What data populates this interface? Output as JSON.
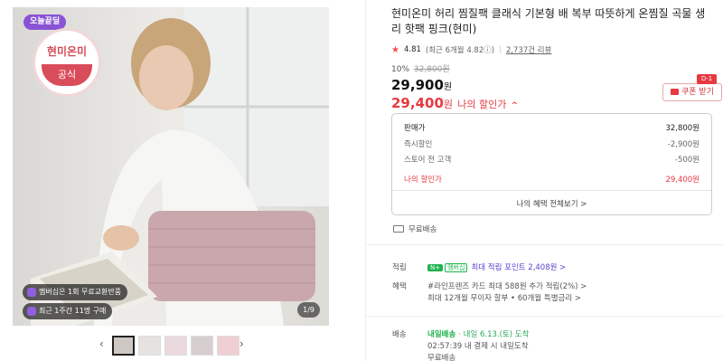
{
  "gallery": {
    "badge_today": "오늘끝딜",
    "brand_stamp_top": "현미온미",
    "brand_stamp_bottom": "공식",
    "pill_membership": "멤버십은 1회 무료교환반품",
    "pill_recent": "최근 1주간 11명 구매",
    "counter": "1/9",
    "arrow_left": "‹",
    "arrow_right": "›"
  },
  "product": {
    "title": "현미온미 허리 찜질팩 클래식 기본형 배 복부 따뜻하게 온찜질 곡물 생리 핫팩 핑크(현미)",
    "rating_star": "★",
    "rating_score": "4.81",
    "rating_recent": "(최근 6개월 4.82ⓘ)",
    "rating_sep": "|",
    "review_count": "2,737건 리뷰",
    "discount_pct": "10%",
    "original_price": "32,800원",
    "sale_price": "29,900",
    "sale_unit": "원",
    "my_price": "29,400",
    "my_unit": "원",
    "my_label": "나의 할인가",
    "my_caret": "^"
  },
  "coupon": {
    "dday": "D-1",
    "label": "쿠폰 받기"
  },
  "price_box": {
    "sale_label": "판매가",
    "sale_value": "32,800원",
    "instant_label": "즉시할인",
    "instant_value": "-2,900원",
    "store_label": "스토어 전 고객",
    "store_value": "-500원",
    "mine_label": "나의 할인가",
    "mine_value": "29,400원",
    "all_benefits": "나의 혜택 전체보기 >"
  },
  "shipping": {
    "free": "무료배송"
  },
  "points": {
    "label": "적립",
    "npay": "N+",
    "npoint": "멤버십",
    "text": "최대 적립 포인트 2,408원 >"
  },
  "benefits": {
    "label": "혜택",
    "line1": "#라인프렌즈 카드 최대 588원 추가 적립(2%) >",
    "line2": "최대 12개월 무이자 할부 • 60개월 특별금리 >"
  },
  "delivery": {
    "label": "배송",
    "tomorrow": "내일배송",
    "date": "· 내일 6.13.(토) 도착",
    "deadline": "02:57:39  내 결제 시 내일도착",
    "free": "무료배송"
  },
  "colors": {
    "accent_red": "#e63940",
    "naver_green": "#1fb34f",
    "badge_purple": "#8a53d6"
  }
}
